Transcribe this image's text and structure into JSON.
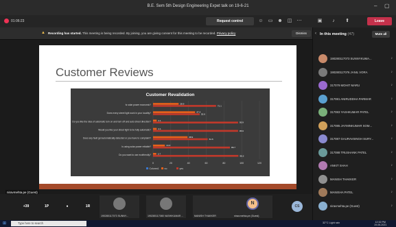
{
  "window": {
    "title": "B.E. Sem 5th Design Engineering Expet talk on 19-6-21"
  },
  "toolbar": {
    "timer": "01:06:23",
    "request_control": "Request control",
    "leave": "Leave"
  },
  "banner": {
    "bold": "Recording has started.",
    "text": " This meeting is being recorded. By joining, you are giving consent for this meeting to be recorded.",
    "link": "Privacy policy",
    "dismiss": "Dismiss"
  },
  "slide": {
    "title": "Customer Reviews"
  },
  "chart_data": {
    "type": "bar",
    "orientation": "horizontal",
    "title": "Customer Revalidation",
    "categories": [
      "Is solar power economic?",
      "Does every street light work in your locality?",
      "Do you like the idea of automatic turn on and turn off and auto street direction?",
      "Would you like your street light to be fully automatic?",
      "Does any fault get automatically detected or you have to complaint?",
      "Is using solar power reliable?",
      "Do you want to use ecofriendly?"
    ],
    "series": [
      {
        "name": "no",
        "values": [
          28.9,
          47.4,
          4.1,
          4.1,
          38.9,
          13.3,
          3.7
        ],
        "color": "#e8611a"
      },
      {
        "name": "yes",
        "values": [
          71.1,
          52.6,
          95.9,
          95.9,
          61.6,
          86.7,
          96.3
        ],
        "color": "#c0392b"
      }
    ],
    "data_labels": [
      "28.9",
      "71.1",
      "47.4",
      "52.6",
      "4.1",
      "95.9",
      "4.1",
      "95.9",
      "38.9",
      "61.6",
      "13.3",
      "86.7",
      "3.7",
      "96.3"
    ],
    "xlim": [
      0,
      120
    ],
    "xticks": [
      "0",
      "20",
      "40",
      "60",
      "80",
      "100",
      "120"
    ],
    "legend": [
      "Column1",
      "no",
      "yes"
    ],
    "legend_position": "bottom",
    "grid": true
  },
  "name_tag": "niravmehta.pe (Guest)",
  "gallery": {
    "bubbles": [
      {
        "label": "+39",
        "color": "#6264a7"
      },
      {
        "label": "1P",
        "color": "#8b8fe0"
      },
      {
        "label": "",
        "color": "#111111"
      },
      {
        "label": "1R",
        "color": "#e59a9a"
      }
    ],
    "tiles": [
      {
        "name": "190280117073 SUNNY...",
        "initial": ""
      },
      {
        "name": "190280117080 VASHIKUMAR ...",
        "initial": ""
      },
      {
        "name": "MANISH THAKKER",
        "initial": ""
      },
      {
        "name": "nirav.mehta.pe (Guest)",
        "initial": "N"
      }
    ],
    "cs_label": "CS"
  },
  "panel": {
    "title": "In this meeting",
    "count": "(47)",
    "mute_all": "Mute all",
    "participants": [
      "190280117073 SUNNYKUMA...",
      "190280117076 JANIL VORA",
      "317079 MOHIT MARU",
      "317081 ANIRUDDHA PARMAR",
      "317083 YASHKUMAR PATEL",
      "317085 JAYMINKUMAR SOM...",
      "317087 GAURAVSINGH SURY...",
      "317088 TRUSHANK PATEL",
      "ANKIT SHAH",
      "MANISH THAKKER",
      "MANISHA PATEL",
      "niravmehta.pe (Guest)"
    ]
  },
  "taskbar": {
    "search": "Type here to search",
    "weather": "32°C Light rain",
    "time": "12:32 PM",
    "date": "19-06-2021"
  }
}
